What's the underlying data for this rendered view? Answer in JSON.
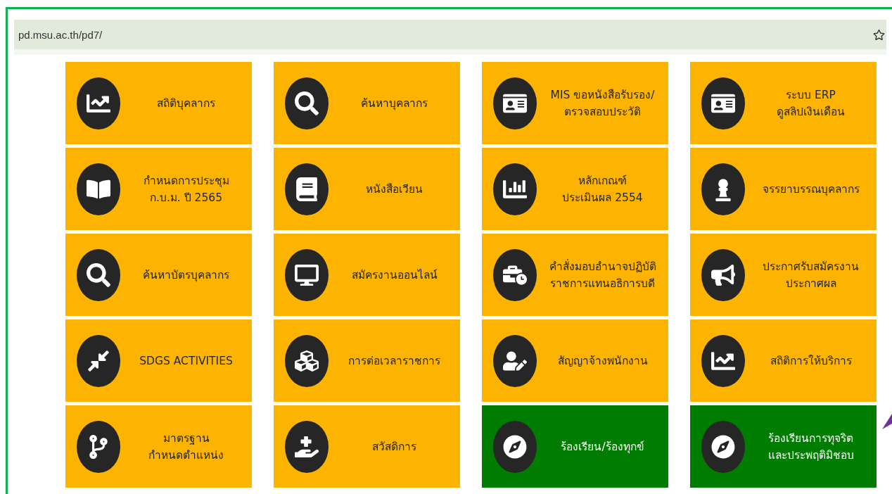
{
  "address_bar": {
    "url": "pd.msu.ac.th/pd7/"
  },
  "tiles": [
    {
      "label": "สถิติบุคลากร",
      "color": "#fdb400"
    },
    {
      "label": "ค้นหาบุคลากร",
      "color": "#fdb400"
    },
    {
      "label": "MIS ขอหนังสือรับรอง/\nตรวจสอบประวัติ",
      "color": "#fdb400"
    },
    {
      "label": "ระบบ ERP\nดูสลิปเงินเดือน",
      "color": "#fdb400"
    },
    {
      "label": "กำหนดการประชุม\nก.บ.ม. ปี 2565",
      "color": "#fdb400"
    },
    {
      "label": "หนังสือเวียน",
      "color": "#fdb400"
    },
    {
      "label": "หลักเกณฑ์\nประเมินผล 2554",
      "color": "#fdb400"
    },
    {
      "label": "จรรยาบรรณบุคลากร",
      "color": "#fdb400"
    },
    {
      "label": "ค้นหาบัตรบุคลากร",
      "color": "#fdb400"
    },
    {
      "label": "สมัครงานออนไลน์",
      "color": "#fdb400"
    },
    {
      "label": "คำสั่งมอบอำนาจปฏิบัติ\nราชการแทนอธิการบดี",
      "color": "#fdb400"
    },
    {
      "label": "ประกาศรับสมัครงาน\nประกาศผล",
      "color": "#fdb400"
    },
    {
      "label": "SDGS ACTIVITIES",
      "color": "#fdb400"
    },
    {
      "label": "การต่อเวลาราชการ",
      "color": "#fdb400"
    },
    {
      "label": "สัญญาจ้างพนักงาน",
      "color": "#fdb400"
    },
    {
      "label": "สถิติการให้บริการ",
      "color": "#fdb400"
    },
    {
      "label": "มาตรฐาน\nกำหนดตำแหน่ง",
      "color": "#fdb400"
    },
    {
      "label": "สวัสดิการ",
      "color": "#fdb400"
    },
    {
      "label": "ร้องเรียน/ร้องทุกข์",
      "color": "#007d00"
    },
    {
      "label": "ร้องเรียนการทุจริต\nและประพฤติมิชอบ",
      "color": "#007d00"
    }
  ]
}
